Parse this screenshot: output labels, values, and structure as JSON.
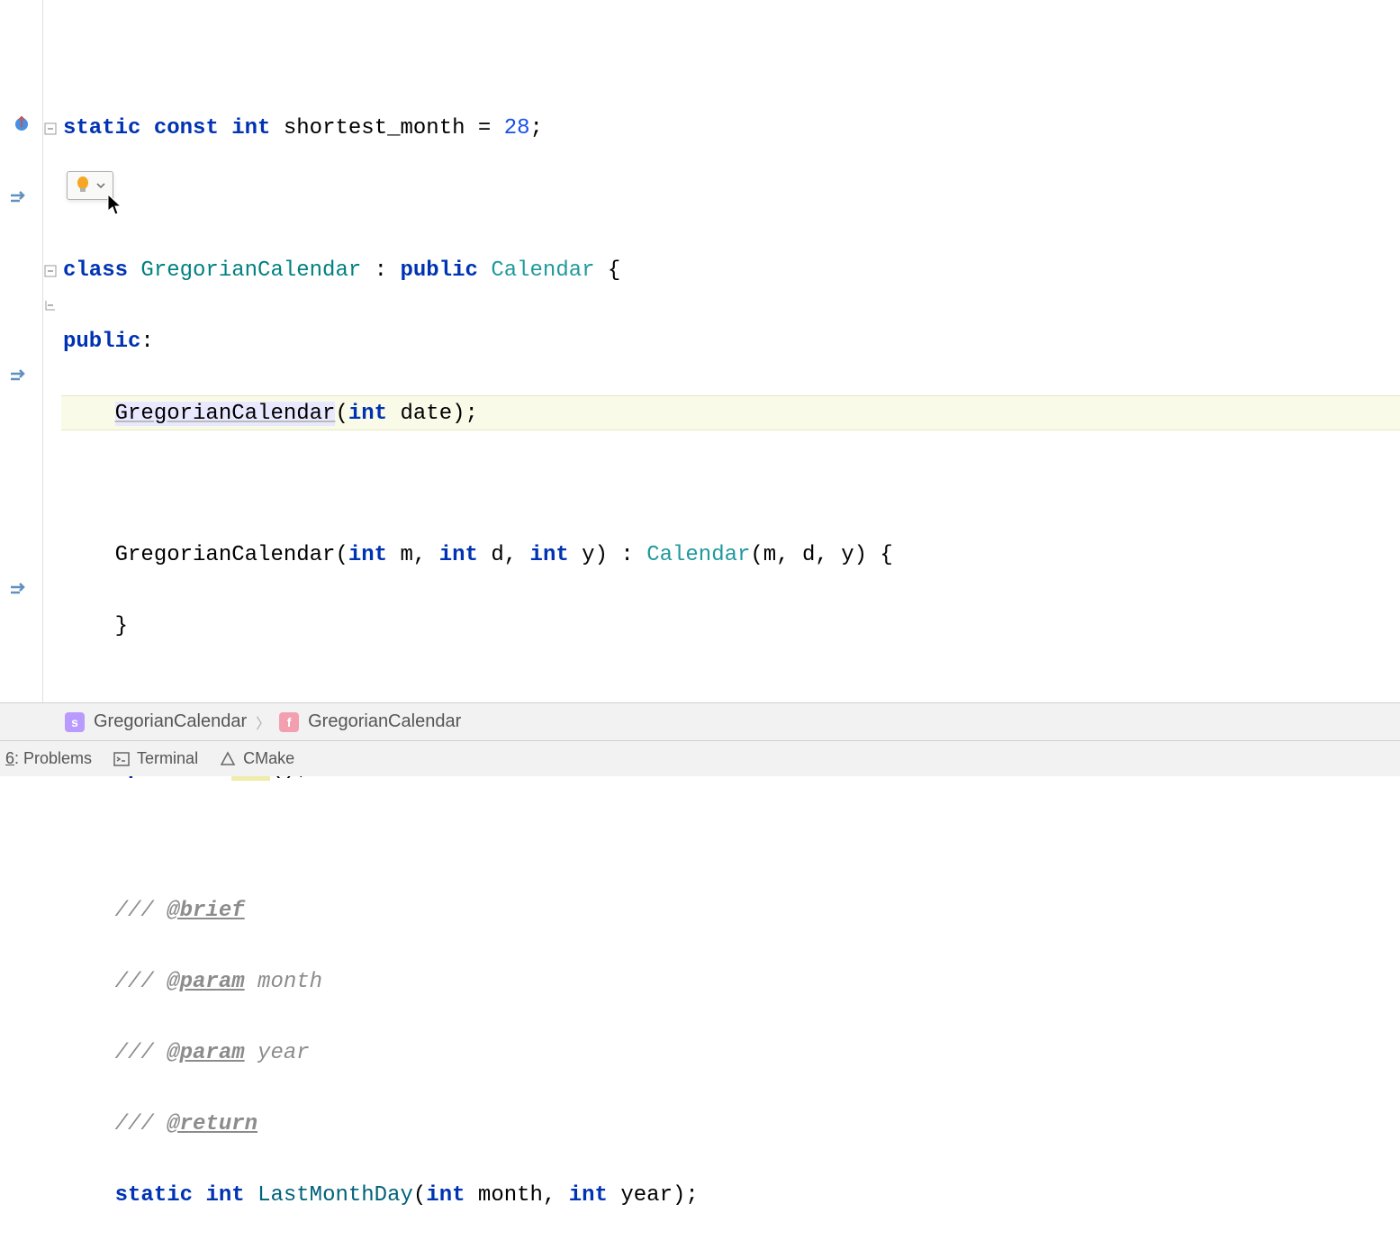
{
  "code": {
    "line1": {
      "kw1": "static",
      "kw2": "const",
      "kw3": "int",
      "ident": "shortest_month",
      "eq": " = ",
      "val": "28",
      "semi": ";"
    },
    "line3": {
      "kw1": "class",
      "name": "GregorianCalendar",
      "sep": " : ",
      "kw2": "public",
      "base": "Calendar",
      "brace": " {"
    },
    "line4": {
      "kw": "public",
      "colon": ":"
    },
    "line5": {
      "name": "GregorianCalendar",
      "open": "(",
      "kw": "int",
      "param": " date",
      "close": ");"
    },
    "line7": {
      "name": "GregorianCalendar",
      "params_open": "(",
      "p1t": "int",
      "p1n": " m",
      "c1": ", ",
      "p2t": "int",
      "p2n": " d",
      "c2": ", ",
      "p3t": "int",
      "p3n": " y",
      "params_close": ") : ",
      "base": "Calendar",
      "args": "(m, d, y) {"
    },
    "line8": {
      "brace": "}"
    },
    "line10": {
      "kw": "operator",
      "sp": " ",
      "type": "int",
      "call": "();"
    },
    "line12": {
      "c": "/// ",
      "tag": "@brief"
    },
    "line13": {
      "c": "/// ",
      "tag": "@param",
      "p": " month"
    },
    "line14": {
      "c": "/// ",
      "tag": "@param",
      "p": " year"
    },
    "line15": {
      "c": "/// ",
      "tag": "@return"
    },
    "line16": {
      "kw1": "static",
      "kw2": "int",
      "name": "LastMonthDay",
      "open": "(",
      "p1t": "int",
      "p1n": " month",
      "c1": ", ",
      "p2t": "int",
      "p2n": " year",
      "close": ");"
    }
  },
  "breadcrumbs": {
    "item1_icon": "s",
    "item1_label": "GregorianCalendar",
    "sep": "〉",
    "item2_icon": "f",
    "item2_label": "GregorianCalendar"
  },
  "bottom_tabs": {
    "problems_num": "6",
    "problems_label": ": Problems",
    "terminal_label": "Terminal",
    "cmake_label": "CMake"
  }
}
